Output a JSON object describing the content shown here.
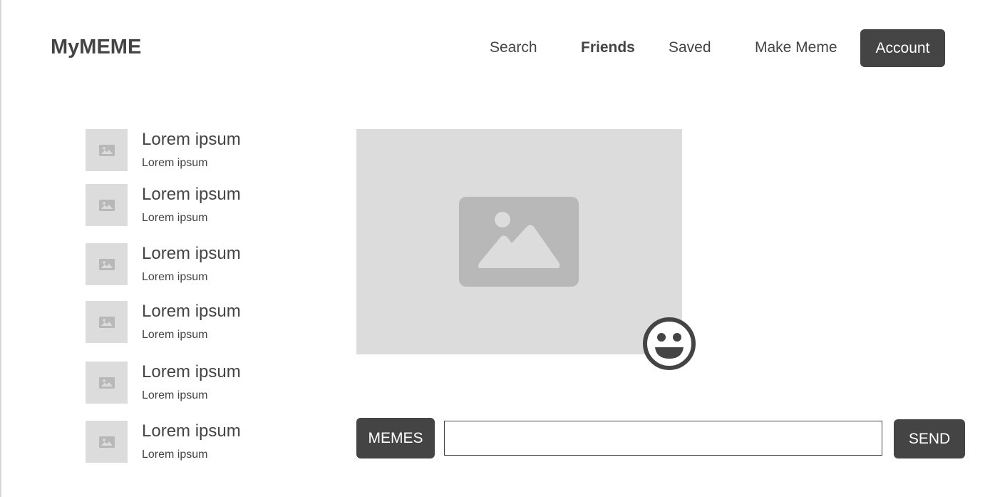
{
  "header": {
    "brand": "MyMEME",
    "nav": [
      {
        "label": "Search",
        "active": false
      },
      {
        "label": "Friends",
        "active": true
      },
      {
        "label": "Saved",
        "active": false
      },
      {
        "label": "Make Meme",
        "active": false
      }
    ],
    "account_label": "Account"
  },
  "friends": [
    {
      "name": "Lorem ipsum",
      "subtitle": "Lorem ipsum",
      "icon": "image-placeholder-icon"
    },
    {
      "name": "Lorem ipsum",
      "subtitle": "Lorem ipsum",
      "icon": "image-placeholder-icon"
    },
    {
      "name": "Lorem ipsum",
      "subtitle": "Lorem ipsum",
      "icon": "image-placeholder-icon"
    },
    {
      "name": "Lorem ipsum",
      "subtitle": "Lorem ipsum",
      "icon": "image-placeholder-icon"
    },
    {
      "name": "Lorem ipsum",
      "subtitle": "Lorem ipsum",
      "icon": "image-placeholder-icon"
    },
    {
      "name": "Lorem ipsum",
      "subtitle": "Lorem ipsum",
      "icon": "image-placeholder-icon"
    }
  ],
  "chat": {
    "meme_icon": "image-placeholder-icon",
    "emoji_icon": "smiley-face-icon",
    "memes_label": "MEMES",
    "message_value": "",
    "send_label": "SEND"
  },
  "colors": {
    "dark": "#444444",
    "placeholder_bg": "#dcdcdc",
    "placeholder_icon": "#b8b8b8"
  }
}
